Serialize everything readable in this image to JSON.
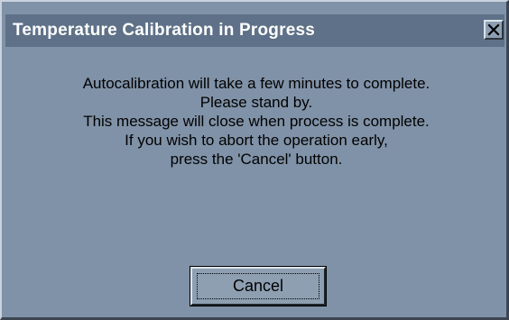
{
  "window": {
    "title": "Temperature Calibration in Progress",
    "close_icon": "close-icon"
  },
  "message": {
    "lines": [
      "Autocalibration  will take a few minutes to complete.",
      "Please stand by.",
      "This message will close when process is complete.",
      "If you wish to abort the operation early,",
      "press the 'Cancel' button."
    ]
  },
  "buttons": {
    "cancel_label": "Cancel"
  },
  "colors": {
    "dialog_bg": "#8092a7",
    "titlebar_bg": "#5e7188",
    "title_text": "#ffffff"
  }
}
